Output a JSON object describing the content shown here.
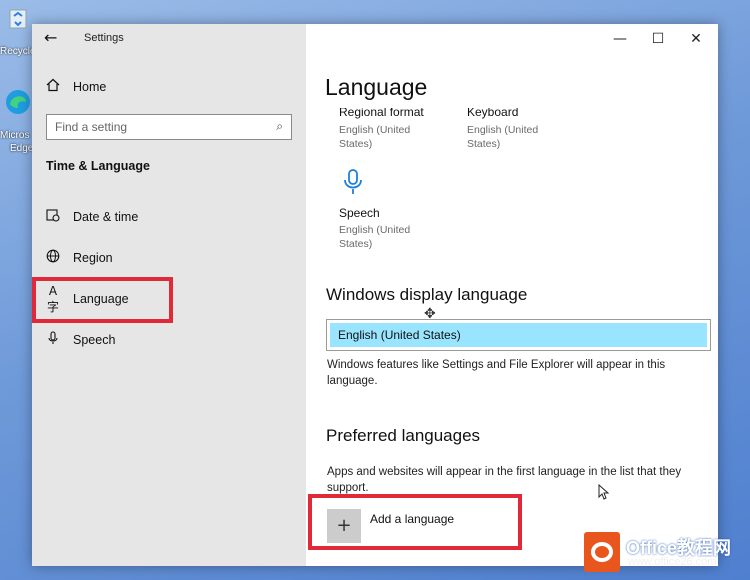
{
  "desktop": {
    "recycle_label": "Recycle",
    "edge_label_1": "Micros",
    "edge_label_2": "Edge"
  },
  "window": {
    "app_title": "Settings",
    "controls": {
      "minimize": "—",
      "maximize": "☐",
      "close": "✕"
    }
  },
  "sidebar": {
    "home_label": "Home",
    "search_placeholder": "Find a setting",
    "section_heading": "Time & Language",
    "items": [
      {
        "label": "Date & time",
        "icon": "calendar-clock-icon"
      },
      {
        "label": "Region",
        "icon": "globe-icon"
      },
      {
        "label": "Language",
        "icon": "language-icon"
      },
      {
        "label": "Speech",
        "icon": "microphone-icon"
      }
    ]
  },
  "main": {
    "page_title": "Language",
    "tiles": [
      {
        "title": "Regional format",
        "sub": "English (United States)"
      },
      {
        "title": "Keyboard",
        "sub": "English (United States)"
      },
      {
        "title": "Speech",
        "sub": "English (United States)",
        "icon": "microphone-icon"
      }
    ],
    "display_language": {
      "heading": "Windows display language",
      "selected": "English (United States)",
      "description": "Windows features like Settings and File Explorer will appear in this language."
    },
    "preferred": {
      "heading": "Preferred languages",
      "description": "Apps and websites will appear in the first language in the list that they support.",
      "add_label": "Add a language"
    }
  },
  "highlight_color": "#e02a3a",
  "selection_color": "#99e5ff",
  "watermark": {
    "brand": "Office教程网",
    "url": "www.office26.com"
  }
}
